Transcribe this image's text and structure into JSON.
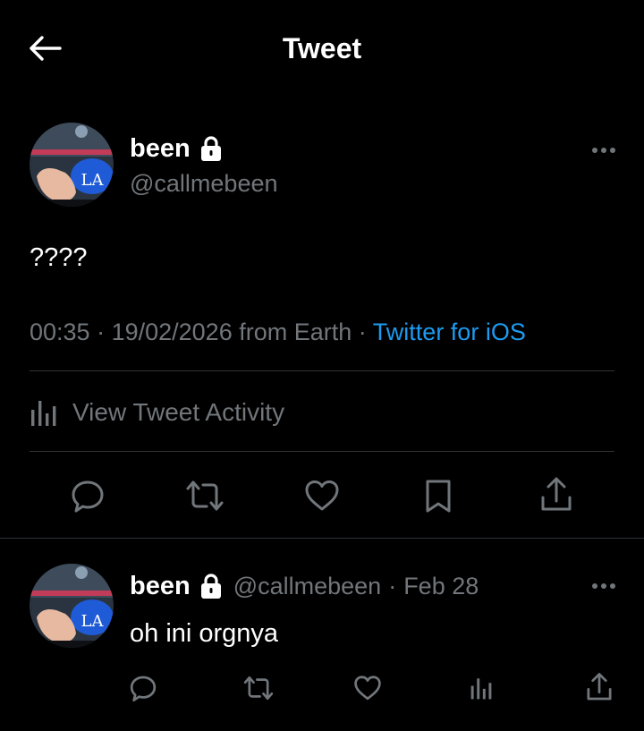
{
  "header": {
    "title": "Tweet"
  },
  "tweet": {
    "author_name": "been",
    "author_handle": "@callmebeen",
    "text": "????",
    "time": "00:35",
    "date": "19/02/2026",
    "location_text": "from Earth",
    "source": "Twitter for iOS",
    "activity_label": "View Tweet Activity",
    "actions": [
      "reply-icon",
      "retweet-icon",
      "like-icon",
      "bookmark-icon",
      "share-icon"
    ]
  },
  "reply": {
    "author_name": "been",
    "author_handle": "@callmebeen",
    "date": "Feb 28",
    "text": "oh ini orgnya",
    "actions": [
      "reply-icon",
      "retweet-icon",
      "like-icon",
      "analytics-icon",
      "share-icon"
    ]
  },
  "colors": {
    "background": "#000000",
    "text_primary": "#ffffff",
    "text_secondary": "#71767b",
    "link": "#1d9bf0",
    "divider": "#2f3336"
  }
}
